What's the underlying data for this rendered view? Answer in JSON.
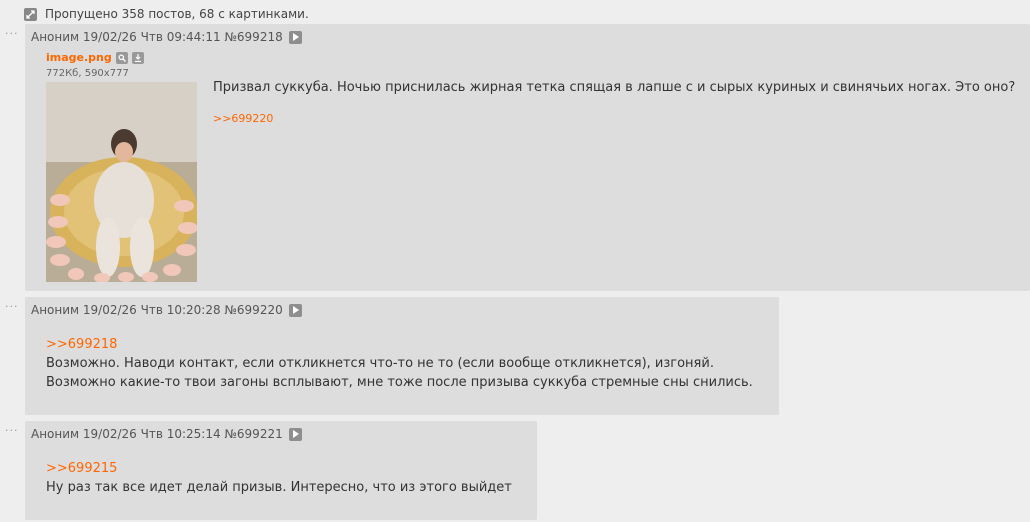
{
  "skipped": {
    "text": "Пропущено 358 постов, 68 с картинками."
  },
  "posts": [
    {
      "header": "Аноним 19/02/26 Чтв 09:44:11 №699218",
      "file": {
        "name": "image.png",
        "meta": "772Кб, 590x777"
      },
      "text": "Призвал суккуба. Ночью приснилась жирная тетка спящая в лапше с и сырых куриных и свинячьих ногах. Это оно?",
      "reply": ">>699220"
    },
    {
      "header": "Аноним 19/02/26 Чтв 10:20:28 №699220",
      "quote": ">>699218",
      "lines": [
        "Возможно. Наводи контакт, если откликнется что-то не то (если вообще откликнется), изгоняй.",
        "Возможно какие-то твои загоны всплывают, мне тоже после призыва суккуба стремные сны снились."
      ]
    },
    {
      "header": "Аноним 19/02/26 Чтв 10:25:14 №699221",
      "quote": ">>699215",
      "lines": [
        "Ну раз так все идет делай призыв. Интересно, что из этого выйдет"
      ]
    }
  ]
}
